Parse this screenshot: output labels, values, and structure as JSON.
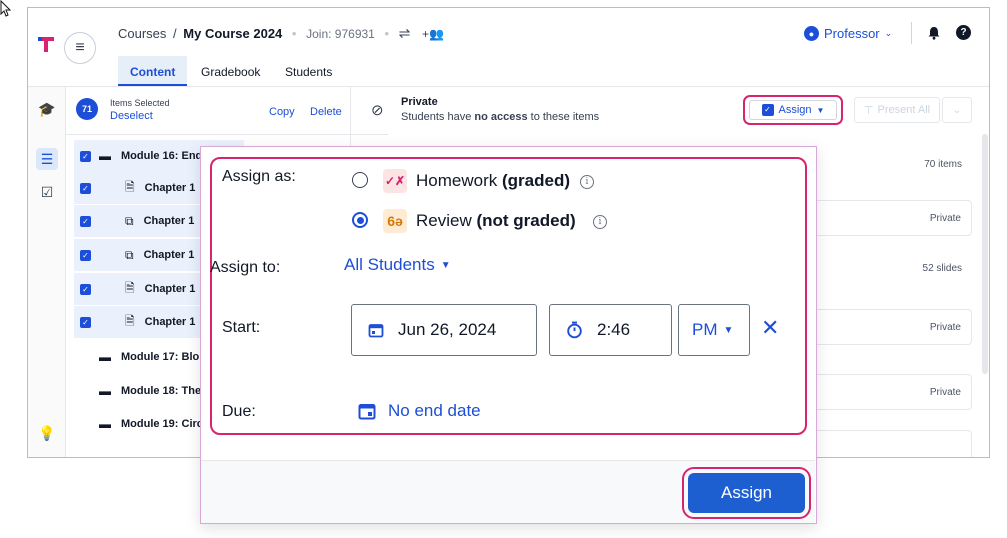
{
  "header": {
    "breadcrumb_root": "Courses",
    "breadcrumb_sep": "/",
    "course_title": "My Course 2024",
    "join_label": "Join: 976931",
    "dot": "•",
    "menu_icon": "hamburger-icon",
    "settings_icon": "sliders-icon",
    "add_people_icon": "add-people-icon",
    "role": "Professor",
    "bell_icon": "bell-icon",
    "help_icon": "help-icon"
  },
  "tabs": [
    {
      "label": "Content",
      "active": true
    },
    {
      "label": "Gradebook",
      "active": false
    },
    {
      "label": "Students",
      "active": false
    }
  ],
  "rail": [
    "graduation-cap-icon",
    "list-icon",
    "checklist-icon",
    "lightbulb-icon"
  ],
  "selection": {
    "count": "71",
    "label": "Items Selected",
    "deselect": "Deselect",
    "copy": "Copy",
    "delete": "Delete"
  },
  "tree": [
    {
      "label": "Module 16: End",
      "icon": "folder-icon",
      "checked": true
    },
    {
      "label": "Chapter 1",
      "icon": "document-icon",
      "checked": true
    },
    {
      "label": "Chapter 1",
      "icon": "presentation-icon",
      "checked": true
    },
    {
      "label": "Chapter 1",
      "icon": "presentation-icon",
      "checked": true
    },
    {
      "label": "Chapter 1",
      "icon": "document-icon",
      "checked": true
    },
    {
      "label": "Chapter 1",
      "icon": "document-icon",
      "checked": true
    },
    {
      "label": "Module 17: Blo",
      "icon": "folder-icon",
      "checked": false
    },
    {
      "label": "Module 18: The",
      "icon": "folder-icon",
      "checked": false
    },
    {
      "label": "Module 19: Circ",
      "icon": "folder-icon",
      "checked": false
    }
  ],
  "visibility": {
    "title": "Private",
    "desc_pre": "Students have ",
    "desc_bold": "no access",
    "desc_post": " to these items"
  },
  "toolbar": {
    "assign": "Assign",
    "present_all": "Present All"
  },
  "cards": [
    "70 items",
    "Private",
    "52 slides",
    "Private",
    "Private"
  ],
  "assign_dialog": {
    "assign_as_label": "Assign as:",
    "homework_label": "Homework",
    "homework_qualifier": "(graded)",
    "review_label": "Review",
    "review_qualifier": "(not graded)",
    "selected_option": "review",
    "assign_to_label": "Assign to:",
    "assign_to_value": "All Students",
    "start_label": "Start:",
    "start_date": "Jun 26, 2024",
    "start_time": "2:46",
    "start_ampm": "PM",
    "due_label": "Due:",
    "due_value": "No end date",
    "submit": "Assign"
  },
  "colors": {
    "accent": "#1d4ed8",
    "highlight": "#d6246e",
    "homework_icon_bg": "#fde4e4",
    "review_icon_bg": "#fdebd3"
  }
}
